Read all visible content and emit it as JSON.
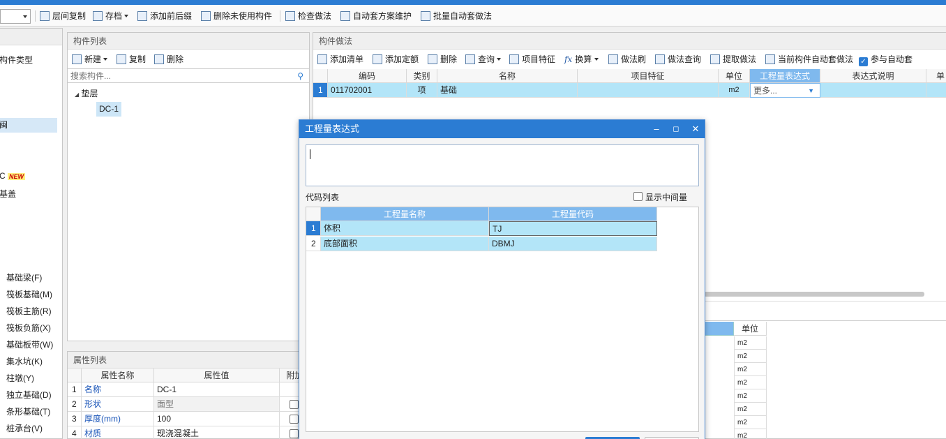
{
  "toolbar": {
    "items": [
      {
        "label": "层间复制",
        "icon": "copy-layers-icon"
      },
      {
        "label": "存档",
        "icon": "archive-icon"
      },
      {
        "label": "添加前后缀",
        "icon": "add-prefix-icon"
      },
      {
        "label": "删除未使用构件",
        "icon": "delete-unused-icon"
      },
      {
        "label": "检查做法",
        "icon": "check-method-icon"
      },
      {
        "label": "自动套方案维护",
        "icon": "auto-scheme-icon"
      },
      {
        "label": "批量自动套做法",
        "icon": "batch-auto-icon"
      }
    ]
  },
  "left_tree": {
    "items": [
      "构件类型",
      "",
      "",
      "",
      "闽",
      "",
      "C",
      "基盖",
      "基础梁(F)",
      "筏板基础(M)",
      "筏板主筋(R)",
      "筏板负筋(X)",
      "基础板带(W)",
      "集水坑(K)",
      "柱墩(Y)",
      "独立基础(D)",
      "条形基础(T)",
      "桩承台(V)"
    ],
    "new_badge": "NEW"
  },
  "component_list": {
    "title": "构件列表",
    "new_label": "新建",
    "copy_label": "复制",
    "delete_label": "删除",
    "search_placeholder": "搜索构件...",
    "group": "垫层",
    "selected_item": "DC-1"
  },
  "properties": {
    "title": "属性列表",
    "headers": [
      "属性名称",
      "属性值",
      "附加"
    ],
    "rows": [
      {
        "index": "1",
        "name": "名称",
        "value": "DC-1"
      },
      {
        "index": "2",
        "name": "形状",
        "value": "面型"
      },
      {
        "index": "3",
        "name": "厚度(mm)",
        "value": "100"
      },
      {
        "index": "4",
        "name": "材质",
        "value": "现浇混凝土"
      }
    ]
  },
  "method_panel": {
    "title": "构件做法",
    "toolbar": [
      "添加清单",
      "添加定额",
      "删除",
      "查询",
      "项目特征",
      "换算",
      "做法刷",
      "做法查询",
      "提取做法",
      "当前构件自动套做法",
      "参与自动套"
    ],
    "headers": [
      "编码",
      "类别",
      "名称",
      "项目特征",
      "单位",
      "工程量表达式",
      "表达式说明",
      "单"
    ],
    "row": {
      "index": "1",
      "code": "011702001",
      "type": "项",
      "name": "基础",
      "feature": "",
      "unit": "m2",
      "expression": "更多...",
      "desc": ""
    }
  },
  "bottom_right": {
    "unit_header": "单位",
    "units": [
      "m2",
      "m2",
      "m2",
      "m2",
      "m2",
      "m2",
      "m2",
      "m2"
    ]
  },
  "dialog": {
    "title": "工程量表达式",
    "code_list_label": "代码列表",
    "show_intermediate_label": "显示中间量",
    "headers": [
      "工程量名称",
      "工程量代码"
    ],
    "rows": [
      {
        "index": "1",
        "name": "体积",
        "code": "TJ"
      },
      {
        "index": "2",
        "name": "底部面积",
        "code": "DBMJ"
      }
    ]
  },
  "colors": {
    "accent": "#2b7cd3",
    "selection": "#b3e5f8",
    "header_blue": "#7fb9ee"
  }
}
